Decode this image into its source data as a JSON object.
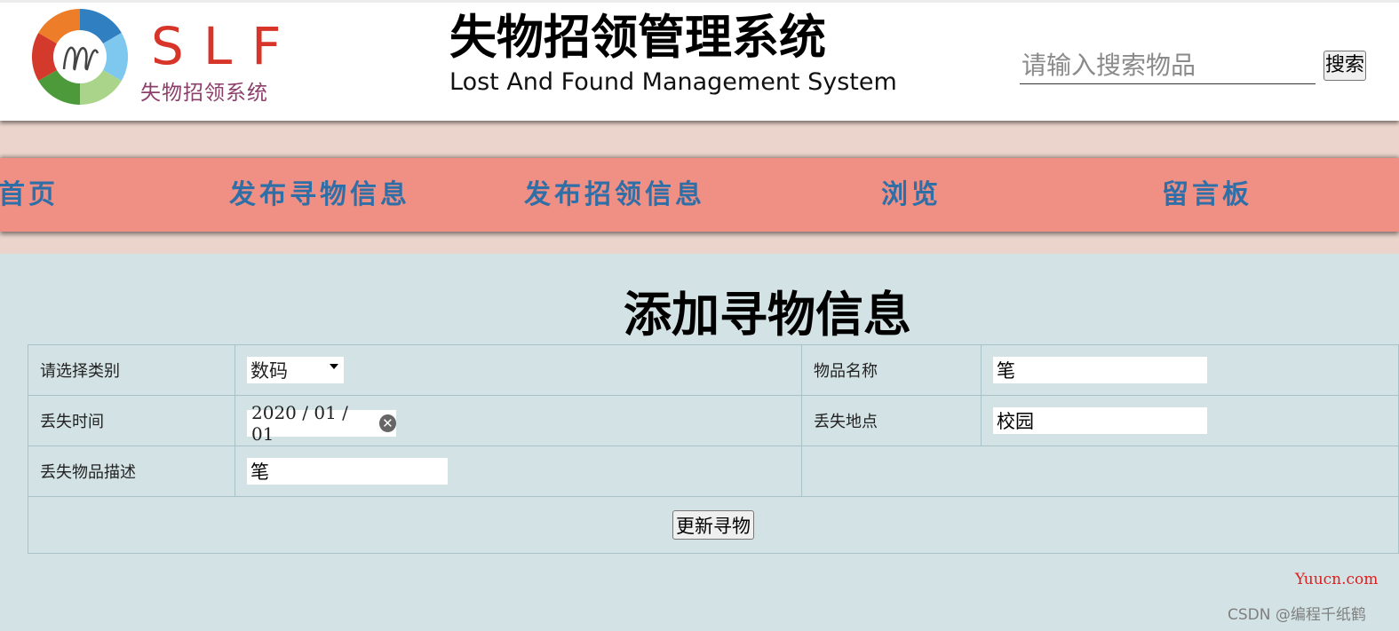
{
  "logo": {
    "main_text": "SLF",
    "sub_text": "失物招领系统",
    "colors": [
      "#e64b25",
      "#2f7fc1",
      "#66b3e8",
      "#9fcf7d",
      "#3b8f2f",
      "#d13a2a"
    ]
  },
  "header": {
    "title_cn": "失物招领管理系统",
    "title_en": "Lost And Found Management System",
    "search_placeholder": "请输入搜索物品",
    "search_button": "搜索"
  },
  "nav": {
    "items": [
      {
        "label": "首页"
      },
      {
        "label": "发布寻物信息"
      },
      {
        "label": "发布招领信息"
      },
      {
        "label": "浏览"
      },
      {
        "label": "留言板"
      }
    ],
    "color": "#2f6fa8",
    "background": "#f08f83"
  },
  "form": {
    "title": "添加寻物信息",
    "category_label": "请选择类别",
    "category_value": "数码",
    "name_label": "物品名称",
    "name_value": "笔",
    "time_label": "丢失时间",
    "time_value": "2020 / 01 / 01",
    "place_label": "丢失地点",
    "place_value": "校园",
    "desc_label": "丢失物品描述",
    "desc_value": "笔",
    "submit_label": "更新寻物"
  },
  "watermarks": {
    "site": "Yuucn.com",
    "author": "CSDN @编程千纸鹤"
  }
}
